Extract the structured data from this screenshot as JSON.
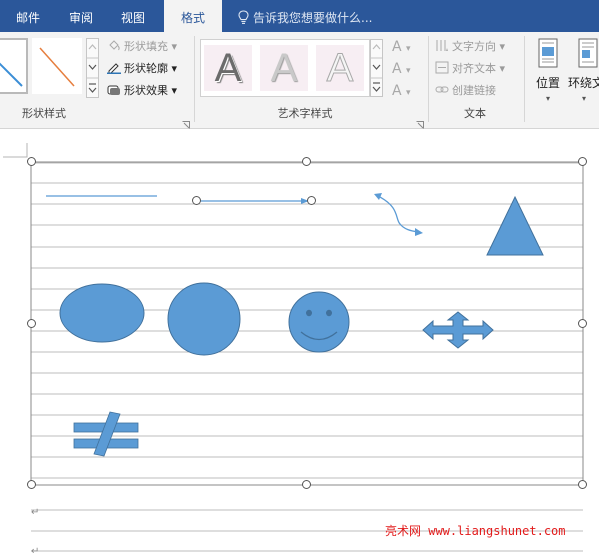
{
  "tabs": [
    {
      "label": "邮件",
      "active": false
    },
    {
      "label": "审阅",
      "active": false
    },
    {
      "label": "视图",
      "active": false
    },
    {
      "label": "格式",
      "active": true
    }
  ],
  "tell_me": "告诉我您想要做什么...",
  "shape_styles": {
    "fill": "形状填充",
    "outline": "形状轮廓",
    "effects": "形状效果",
    "group_label": "形状样式"
  },
  "wordart": {
    "letters": [
      "A",
      "A",
      "A"
    ],
    "group_label": "艺术字样式"
  },
  "text_group": {
    "direction": "文字方向",
    "align": "对齐文本",
    "link": "创建链接",
    "group_label": "文本"
  },
  "arrange": {
    "position": "位置",
    "wrap": "环绕文"
  },
  "watermark": "亮术网 www.liangshunet.com",
  "colors": {
    "ribbon_tab": "#2b579a",
    "shape_fill": "#5b9bd5",
    "shape_outline": "#41719c"
  }
}
